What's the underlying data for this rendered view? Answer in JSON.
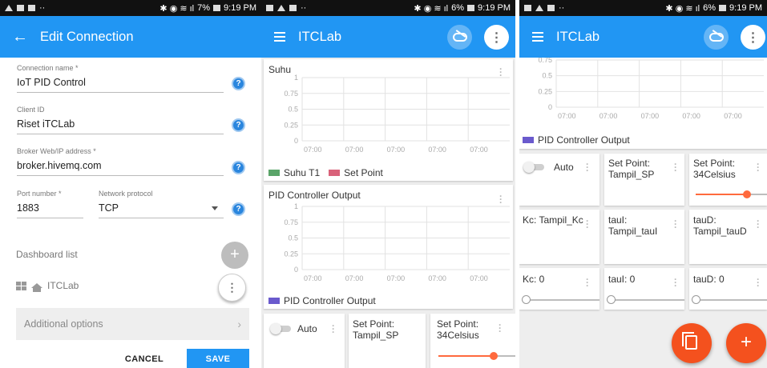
{
  "status": {
    "time": "9:19 PM",
    "battery_left": "7%",
    "battery_other": "6%"
  },
  "edit": {
    "title": "Edit Connection",
    "connection_name_label": "Connection name *",
    "connection_name_value": "IoT PID Control",
    "client_id_label": "Client ID",
    "client_id_value": "Riset iTCLab",
    "broker_label": "Broker Web/IP address *",
    "broker_value": "broker.hivemq.com",
    "port_label": "Port number *",
    "port_value": "1883",
    "protocol_label": "Network protocol",
    "protocol_value": "TCP",
    "dashboard_list_label": "Dashboard list",
    "dashboard_item": "ITCLab",
    "additional_options": "Additional options",
    "cancel": "CANCEL",
    "save": "SAVE"
  },
  "dashboard": {
    "title": "ITCLab",
    "suhu": {
      "title": "Suhu",
      "yticks": [
        "1",
        "0.75",
        "0.5",
        "0.25",
        "0"
      ],
      "xticks": [
        "07:00",
        "07:00",
        "07:00",
        "07:00",
        "07:00"
      ],
      "legend": [
        {
          "name": "Suhu T1",
          "color": "#5aa469"
        },
        {
          "name": "Set Point",
          "color": "#d9627a"
        }
      ]
    },
    "pid": {
      "title": "PID Controller Output",
      "yticks": [
        "1",
        "0.75",
        "0.5",
        "0.25",
        "0"
      ],
      "xticks": [
        "07:00",
        "07:00",
        "07:00",
        "07:00",
        "07:00"
      ],
      "legend": [
        {
          "name": "PID Controller Output",
          "color": "#6a5acd"
        }
      ]
    },
    "pid_scrolled": {
      "yticks": [
        "0.75",
        "0.5",
        "0.25",
        "0"
      ],
      "xticks": [
        "07:00",
        "07:00",
        "07:00",
        "07:00",
        "07:00"
      ],
      "legend": "PID Controller Output"
    },
    "widgets": {
      "auto": "Auto",
      "set_point_name": "Set Point: Tampil_SP",
      "set_point_value": "Set Point: 34Celsius",
      "set_point_level": 0.72,
      "kc_name": "Kc: Tampil_Kc",
      "taui_name": "tauI: Tampil_tauI",
      "taud_name": "tauD: Tampil_tauD",
      "kc_value": "Kc: 0",
      "taui_value": "tauI: 0",
      "taud_value": "tauD: 0"
    }
  },
  "colors": {
    "primary": "#2196f3",
    "accent": "#f4511e"
  }
}
